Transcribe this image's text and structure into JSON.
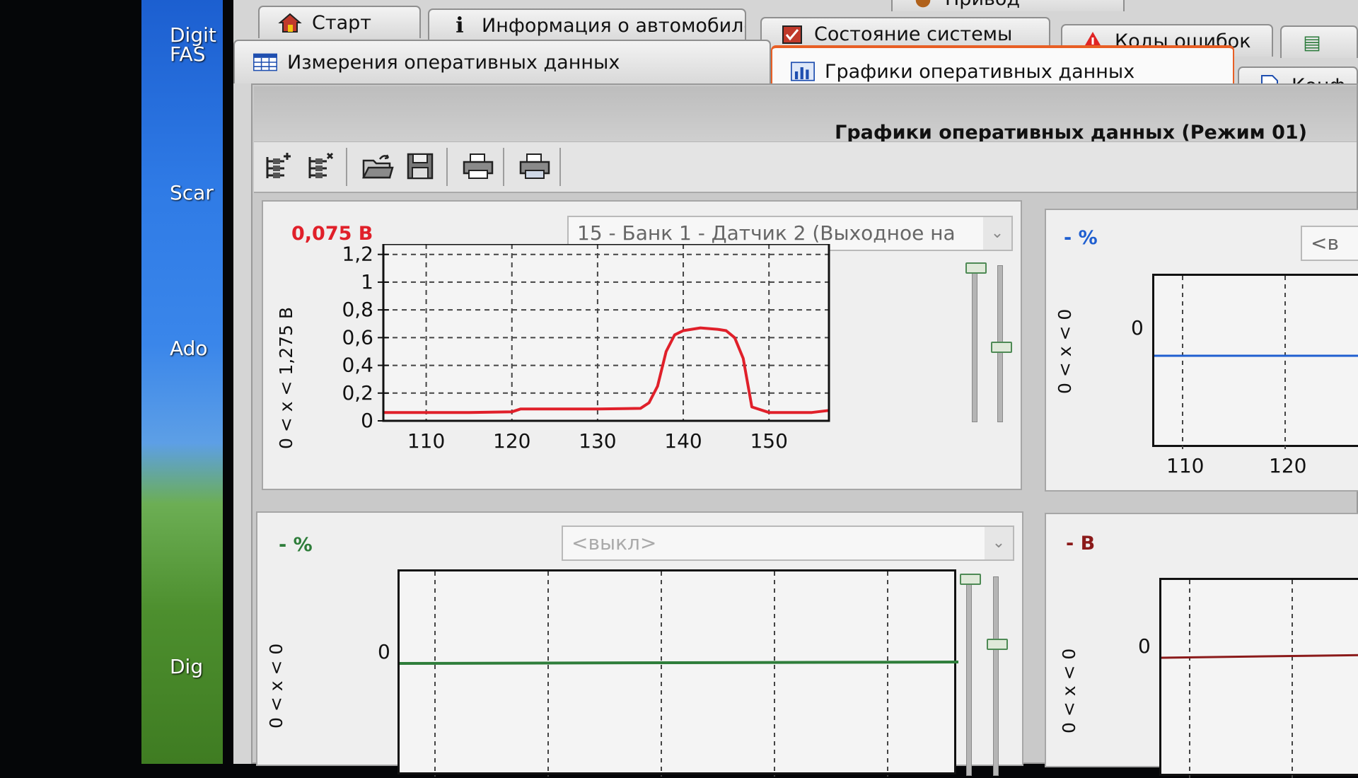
{
  "desktop": {
    "labels": [
      "Digit",
      "FAS",
      "Scar",
      "Ado",
      "Dig"
    ]
  },
  "tabs": {
    "row1": [
      {
        "label": "Старт",
        "icon": "home-icon"
      },
      {
        "label": "Информация о автомобиле",
        "icon": "info-icon"
      },
      {
        "label": "Состояние системы",
        "icon": "system-status-icon"
      },
      {
        "label": "Коды ошибок",
        "icon": "warning-icon"
      }
    ],
    "row0_partial": [
      "Привод"
    ],
    "row2": [
      {
        "label": "Измерения оперативных данных",
        "icon": "table-icon"
      },
      {
        "label": "Графики оперативных данных",
        "icon": "chart-icon",
        "active": true
      },
      {
        "label": "Конф",
        "icon": "document-icon"
      }
    ]
  },
  "section": {
    "title": "Графики оперативных данных (Режим 01)"
  },
  "toolbar": {
    "tools": [
      "add-graph-icon",
      "remove-graph-icon",
      "open-icon",
      "save-icon",
      "print-icon",
      "print-preview-icon"
    ]
  },
  "panels": {
    "top_left": {
      "readout": "0,075 В",
      "readout_color": "#e0202a",
      "selector": "15 - Банк 1 - Датчик 2 (Выходное на",
      "range_label": "0 < x < 1,275 В",
      "line_color": "#e0202a"
    },
    "top_right": {
      "readout": "- %",
      "readout_color": "#1f5fd0",
      "selector": "<в",
      "range_label": "0 < x < 0",
      "zero_label": "0",
      "x_ticks": [
        "110",
        "120"
      ],
      "line_color": "#1f5fd0"
    },
    "bottom_left": {
      "readout": "- %",
      "readout_color": "#2e7d3a",
      "selector": "<выкл>",
      "range_label": "0 < x < 0",
      "zero_label": "0",
      "line_color": "#2e7d3a"
    },
    "bottom_right": {
      "readout": "- В",
      "readout_color": "#8b1a1a",
      "range_label": "0 < x < 0",
      "zero_label": "0",
      "line_color": "#8b1a1a"
    }
  },
  "chart_data": {
    "type": "line",
    "xlabel": "",
    "ylabel": "0 < x < 1,275 В",
    "xlim": [
      105,
      157
    ],
    "ylim": [
      0,
      1.275
    ],
    "x_ticks": [
      "110",
      "120",
      "130",
      "140",
      "150"
    ],
    "y_ticks": [
      "0",
      "0,2",
      "0,4",
      "0,6",
      "0,8",
      "1",
      "1,2"
    ],
    "grid": true,
    "series": [
      {
        "x": [
          105,
          115,
          120,
          121,
          128,
          130,
          135,
          136,
          137,
          138,
          139,
          140,
          142,
          144,
          145,
          146,
          147,
          148,
          150,
          152,
          155,
          157
        ],
        "y": [
          0.06,
          0.06,
          0.065,
          0.085,
          0.085,
          0.085,
          0.09,
          0.13,
          0.25,
          0.5,
          0.62,
          0.65,
          0.67,
          0.66,
          0.65,
          0.6,
          0.45,
          0.1,
          0.06,
          0.06,
          0.06,
          0.075
        ]
      }
    ]
  }
}
